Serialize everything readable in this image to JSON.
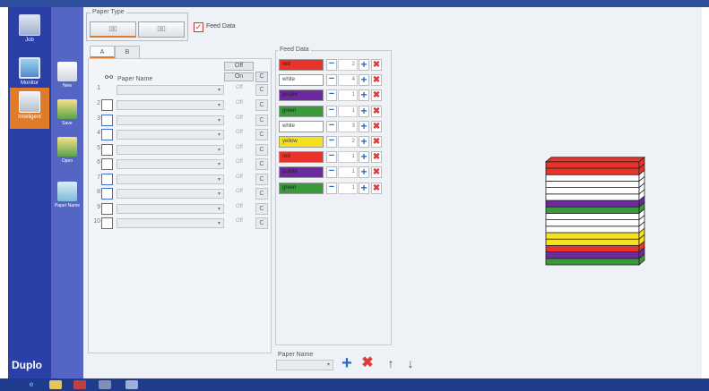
{
  "colors": {
    "red": "#e8332b",
    "white": "#ffffff",
    "purple": "#6b2aa0",
    "green": "#3a9a3a",
    "yellow": "#f5e11f",
    "sidebar": "#2a3fa8",
    "subbar": "#5565c3",
    "accent": "#e07b2a"
  },
  "sidebar": {
    "items": [
      {
        "label": "Job",
        "icon": "document-icon"
      },
      {
        "label": "Monitor",
        "icon": "monitor-icon"
      },
      {
        "label": "Intelligent",
        "icon": "machine-icon"
      }
    ],
    "brand": "Duplo"
  },
  "subnav": {
    "items": [
      {
        "label": "New",
        "icon": "new-file-icon"
      },
      {
        "label": "Save",
        "icon": "save-icon"
      },
      {
        "label": "Open",
        "icon": "open-folder-icon"
      },
      {
        "label": "Paper Name",
        "icon": "paper-name-icon"
      }
    ]
  },
  "paper_type": {
    "title": "Paper Type"
  },
  "feed_data_toggle": {
    "label": "Feed Data",
    "checked": true
  },
  "tabs": [
    {
      "label": "A",
      "active": true
    },
    {
      "label": "B",
      "active": false
    }
  ],
  "paper_panel": {
    "header": "Paper Name",
    "off_all": "Off",
    "on_all": "On",
    "c_all": "C",
    "rows": [
      {
        "num": "1",
        "off": "Off",
        "c": "C",
        "has_checkbox": false
      },
      {
        "num": "2",
        "off": "Off",
        "c": "C",
        "has_checkbox": true
      },
      {
        "num": "3",
        "off": "Off",
        "c": "C",
        "has_checkbox": true
      },
      {
        "num": "4",
        "off": "Off",
        "c": "C",
        "has_checkbox": true
      },
      {
        "num": "5",
        "off": "Off",
        "c": "C",
        "has_checkbox": true
      },
      {
        "num": "6",
        "off": "Off",
        "c": "C",
        "has_checkbox": true
      },
      {
        "num": "7",
        "off": "Off",
        "c": "C",
        "has_checkbox": true
      },
      {
        "num": "8",
        "off": "Off",
        "c": "C",
        "has_checkbox": true
      },
      {
        "num": "9",
        "off": "Off",
        "c": "C",
        "has_checkbox": true
      },
      {
        "num": "10",
        "off": "Off",
        "c": "C",
        "has_checkbox": true
      }
    ]
  },
  "feed_panel": {
    "title": "Feed Data",
    "rows": [
      {
        "name": "red",
        "color": "#e8332b",
        "count": "2"
      },
      {
        "name": "white",
        "color": "#ffffff",
        "count": "4"
      },
      {
        "name": "purple",
        "color": "#6b2aa0",
        "count": "1"
      },
      {
        "name": "green",
        "color": "#3a9a3a",
        "count": "1"
      },
      {
        "name": "white",
        "color": "#ffffff",
        "count": "3"
      },
      {
        "name": "yellow",
        "color": "#f5e11f",
        "count": "2"
      },
      {
        "name": "red",
        "color": "#e8332b",
        "count": "1"
      },
      {
        "name": "purple",
        "color": "#6b2aa0",
        "count": "1"
      },
      {
        "name": "green",
        "color": "#3a9a3a",
        "count": "1"
      }
    ]
  },
  "bottom_controls": {
    "paper_name_label": "Paper Name"
  },
  "stack_layers": [
    "#3a9a3a",
    "#6b2aa0",
    "#e8332b",
    "#f5e11f",
    "#f5e11f",
    "#ffffff",
    "#ffffff",
    "#ffffff",
    "#3a9a3a",
    "#6b2aa0",
    "#ffffff",
    "#ffffff",
    "#ffffff",
    "#ffffff",
    "#e8332b",
    "#e8332b"
  ]
}
